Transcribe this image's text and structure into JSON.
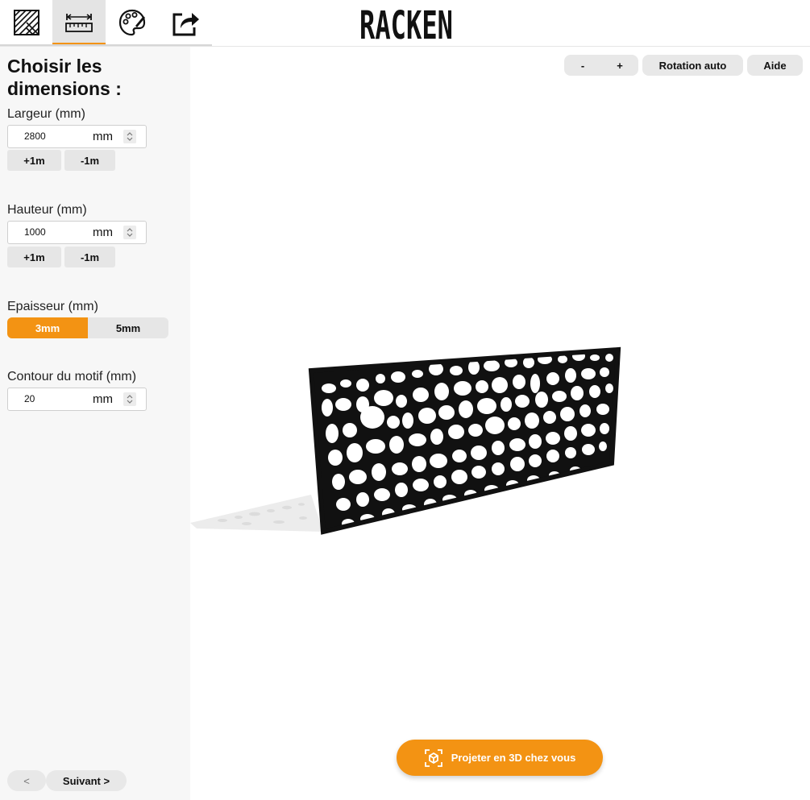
{
  "app": {
    "brand": "RACKEN",
    "accent_color": "#f39313"
  },
  "tabs": [
    {
      "icon": "pattern-icon",
      "active": false
    },
    {
      "icon": "ruler-icon",
      "active": true
    },
    {
      "icon": "palette-icon",
      "active": false
    },
    {
      "icon": "share-icon",
      "active": false
    }
  ],
  "sidebar": {
    "title": "Choisir les dimensions :",
    "width": {
      "label": "Largeur (mm)",
      "value": "2800",
      "unit": "mm",
      "plus_label": "+1m",
      "minus_label": "-1m"
    },
    "height": {
      "label": "Hauteur (mm)",
      "value": "1000",
      "unit": "mm",
      "plus_label": "+1m",
      "minus_label": "-1m"
    },
    "thickness": {
      "label": "Epaisseur (mm)",
      "options": [
        "3mm",
        "5mm"
      ],
      "selected": "3mm"
    },
    "contour": {
      "label": "Contour du motif (mm)",
      "value": "20",
      "unit": "mm"
    },
    "prev_label": "<",
    "next_label": "Suivant >"
  },
  "toolbar": {
    "zoom_out_label": "-",
    "zoom_in_label": "+",
    "rotate_label": "Rotation auto",
    "help_label": "Aide"
  },
  "viewer": {
    "ar_label": "Projeter en 3D chez vous"
  }
}
